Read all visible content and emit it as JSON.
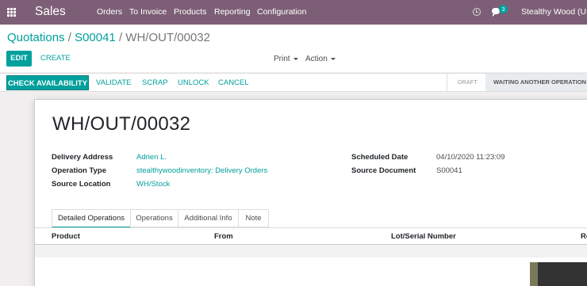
{
  "navbar": {
    "apps_icon": "apps-grid-icon",
    "brand": "Sales",
    "menu": [
      "Orders",
      "To Invoice",
      "Products",
      "Reporting",
      "Configuration"
    ],
    "activity_icon": "clock-icon",
    "chat_icon": "chat-icon",
    "chat_count": "3",
    "company": "Stealthy Wood (USA)"
  },
  "breadcrumb": {
    "root": "Quotations",
    "sep1": "/",
    "middle": "S00041",
    "sep2": "/",
    "current": "WH/OUT/00032"
  },
  "buttons": {
    "edit": "EDIT",
    "create": "CREATE",
    "print": "Print",
    "action": "Action"
  },
  "statusbar": {
    "check_availability": "CHECK AVAILABILITY",
    "validate": "VALIDATE",
    "scrap": "SCRAP",
    "unlock": "UNLOCK",
    "cancel": "CANCEL",
    "stages": [
      "DRAFT",
      "WAITING ANOTHER OPERATION"
    ],
    "active_stage": "WAITING ANOTHER OPERATION"
  },
  "record": {
    "name": "WH/OUT/00032",
    "fields_left": [
      {
        "label": "Delivery Address",
        "value": "Adrien L."
      },
      {
        "label": "Operation Type",
        "value": "stealthywoodinventory: Delivery Orders"
      },
      {
        "label": "Source Location",
        "value": "WH/Stock"
      }
    ],
    "fields_right": [
      {
        "label": "Scheduled Date",
        "value": "04/10/2020 11:23:09"
      },
      {
        "label": "Source Document",
        "value": "S00041"
      }
    ]
  },
  "tabs": [
    "Detailed Operations",
    "Operations",
    "Additional Info",
    "Note"
  ],
  "active_tab": "Detailed Operations",
  "table": {
    "columns": [
      "Product",
      "From",
      "Lot/Serial Number",
      "Re"
    ]
  },
  "colors": {
    "navbar": "#7c5f76",
    "accent": "#00a09d"
  }
}
